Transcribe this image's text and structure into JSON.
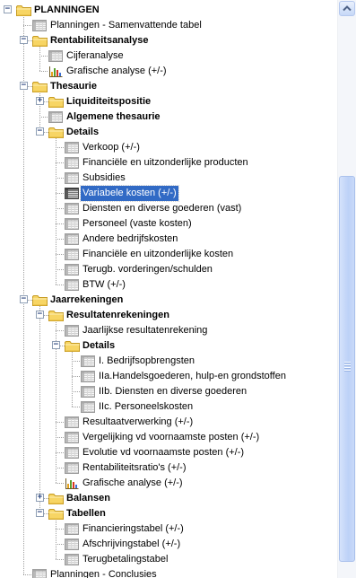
{
  "tree": {
    "items": [
      {
        "label": "PLANNINGEN",
        "level": 0,
        "icon": "folder-icon",
        "bold": true,
        "toggle": "-"
      },
      {
        "label": "Planningen - Samenvattende tabel",
        "level": 1,
        "icon": "table-icon"
      },
      {
        "label": "Rentabiliteitsanalyse",
        "level": 1,
        "icon": "folder-icon",
        "bold": true,
        "toggle": "-"
      },
      {
        "label": "Cijferanalyse",
        "level": 2,
        "icon": "table-icon"
      },
      {
        "label": "Grafische analyse (+/-)",
        "level": 2,
        "icon": "chart-icon"
      },
      {
        "label": "Thesaurie",
        "level": 1,
        "icon": "folder-icon",
        "bold": true,
        "toggle": "-"
      },
      {
        "label": "Liquiditeitspositie",
        "level": 2,
        "icon": "folder-icon",
        "bold": true,
        "toggle": "+"
      },
      {
        "label": "Algemene thesaurie",
        "level": 2,
        "icon": "table-icon",
        "bold": true
      },
      {
        "label": "Details",
        "level": 2,
        "icon": "folder-icon",
        "bold": true,
        "toggle": "-"
      },
      {
        "label": "Verkoop (+/-)",
        "level": 3,
        "icon": "table-icon"
      },
      {
        "label": "Financiële en uitzonderlijke producten",
        "level": 3,
        "icon": "table-icon"
      },
      {
        "label": "Subsidies",
        "level": 3,
        "icon": "table-icon"
      },
      {
        "label": "Variabele kosten (+/-)",
        "level": 3,
        "icon": "table-icon",
        "selected": true
      },
      {
        "label": "Diensten en diverse goederen (vast)",
        "level": 3,
        "icon": "table-icon"
      },
      {
        "label": "Personeel (vaste kosten)",
        "level": 3,
        "icon": "table-icon"
      },
      {
        "label": "Andere bedrijfskosten",
        "level": 3,
        "icon": "table-icon"
      },
      {
        "label": "Financiële en uitzonderlijke kosten",
        "level": 3,
        "icon": "table-icon"
      },
      {
        "label": "Terugb. vorderingen/schulden",
        "level": 3,
        "icon": "table-icon"
      },
      {
        "label": "BTW (+/-)",
        "level": 3,
        "icon": "table-icon"
      },
      {
        "label": "Jaarrekeningen",
        "level": 1,
        "icon": "folder-icon",
        "bold": true,
        "toggle": "-"
      },
      {
        "label": "Resultatenrekeningen",
        "level": 2,
        "icon": "folder-icon",
        "bold": true,
        "toggle": "-"
      },
      {
        "label": "Jaarlijkse resultatenrekening",
        "level": 3,
        "icon": "table-icon"
      },
      {
        "label": "Details",
        "level": 3,
        "icon": "folder-icon",
        "bold": true,
        "toggle": "-"
      },
      {
        "label": "I. Bedrijfsopbrengsten",
        "level": 4,
        "icon": "table-icon"
      },
      {
        "label": "IIa.Handelsgoederen, hulp-en grondstoffen",
        "level": 4,
        "icon": "table-icon"
      },
      {
        "label": "IIb. Diensten en diverse goederen",
        "level": 4,
        "icon": "table-icon"
      },
      {
        "label": "IIc. Personeelskosten",
        "level": 4,
        "icon": "table-icon"
      },
      {
        "label": "Resultaatverwerking (+/-)",
        "level": 3,
        "icon": "table-icon"
      },
      {
        "label": "Vergelijking vd voornaamste posten (+/-)",
        "level": 3,
        "icon": "table-icon"
      },
      {
        "label": "Evolutie vd voornaamste posten (+/-)",
        "level": 3,
        "icon": "table-icon"
      },
      {
        "label": "Rentabiliteitsratio's (+/-)",
        "level": 3,
        "icon": "table-icon"
      },
      {
        "label": "Grafische analyse (+/-)",
        "level": 3,
        "icon": "chart-icon"
      },
      {
        "label": "Balansen",
        "level": 2,
        "icon": "folder-icon",
        "bold": true,
        "toggle": "+"
      },
      {
        "label": "Tabellen",
        "level": 2,
        "icon": "folder-icon",
        "bold": true,
        "toggle": "-"
      },
      {
        "label": "Financieringstabel (+/-)",
        "level": 3,
        "icon": "table-icon"
      },
      {
        "label": "Afschrijvingstabel (+/-)",
        "level": 3,
        "icon": "table-icon"
      },
      {
        "label": "Terugbetalingstabel",
        "level": 3,
        "icon": "table-icon"
      },
      {
        "label": "Planningen - Conclusies",
        "level": 1,
        "icon": "table-icon"
      }
    ]
  },
  "scrollbar": {
    "up_icon": "scroll-up-arrow-icon",
    "position_fraction": 0.3
  },
  "colors": {
    "selection": "#316ac5",
    "folder": "#f7d564",
    "scroll_thumb": "#c6d8f7"
  }
}
